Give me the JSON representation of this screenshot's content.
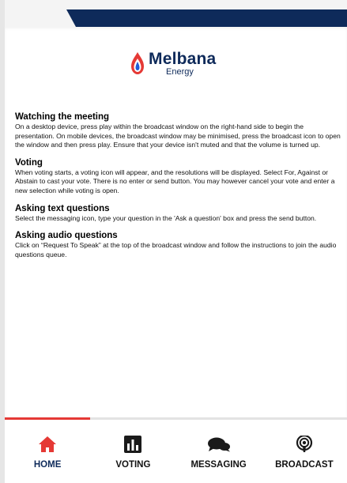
{
  "brand": {
    "name": "Melbana",
    "sub": "Energy"
  },
  "sections": [
    {
      "title": "Watching the meeting",
      "body": "On a desktop device, press play within the broadcast window on the right-hand side to begin the presentation. On mobile devices, the broadcast window may be minimised, press the broadcast icon to open the window and then press play. Ensure that your device isn't muted and that the volume is turned up."
    },
    {
      "title": "Voting",
      "body": "When voting starts, a voting icon will appear, and the resolutions will be displayed. Select For, Against or Abstain to cast your vote. There is no enter or send button. You may however cancel your vote and enter a new selection while voting is open."
    },
    {
      "title": "Asking text questions",
      "body": "Select the messaging icon, type your question in the 'Ask a question' box and press the send button."
    },
    {
      "title": "Asking audio questions",
      "body": "Click on “Request To Speak” at the top of the broadcast window and follow the instructions to join the audio questions queue."
    }
  ],
  "nav": {
    "active_index": 0,
    "items": [
      {
        "label": "HOME",
        "icon": "home-icon"
      },
      {
        "label": "VOTING",
        "icon": "voting-icon"
      },
      {
        "label": "MESSAGING",
        "icon": "messaging-icon"
      },
      {
        "label": "BROADCAST",
        "icon": "broadcast-icon"
      }
    ]
  },
  "colors": {
    "navy": "#0e2a5a",
    "accent_red": "#e53935",
    "logo_blue": "#1f5bd8"
  }
}
